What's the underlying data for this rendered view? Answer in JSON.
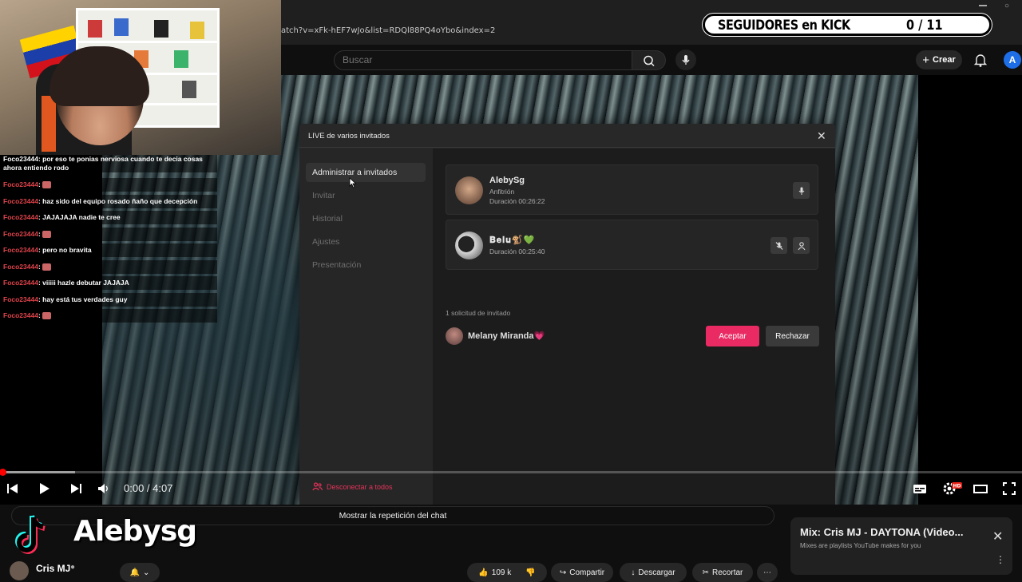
{
  "browser": {
    "url": "atch?v=xFk-hEF7wJo&list=RDQl88PQ4oYbo&index=2"
  },
  "header": {
    "search_placeholder": "Buscar",
    "create_label": "Crear",
    "avatar_letter": "A"
  },
  "overlay": {
    "kick_label": "SEGUIDORES en KICK",
    "kick_count": "0 / 11",
    "tiktok_handle": "Alebysg"
  },
  "chat": {
    "partial_line": "ahora entiendo rodo",
    "partial_top": "Foco23444: por eso te ponias nerviosa cuando te decia cosas",
    "messages": [
      {
        "user": "Foco23444",
        "text": "",
        "emote": true
      },
      {
        "user": "Foco23444",
        "text": "haz sido del equipo rosado ñaño que decepción",
        "emote": false
      },
      {
        "user": "Foco23444",
        "text": "JAJAJAJA nadie te cree",
        "emote": false
      },
      {
        "user": "Foco23444",
        "text": "",
        "emote": true
      },
      {
        "user": "Foco23444",
        "text": "pero no bravita",
        "emote": false
      },
      {
        "user": "Foco23444",
        "text": "",
        "emote": true
      },
      {
        "user": "Foco23444",
        "text": "viiiii hazle debutar JAJAJA",
        "emote": false
      },
      {
        "user": "Foco23444",
        "text": "hay está tus verdades guy",
        "emote": false
      },
      {
        "user": "Foco23444",
        "text": "",
        "emote": true
      }
    ]
  },
  "modal": {
    "title": "LIVE de varios invitados",
    "sidebar": {
      "items": [
        {
          "label": "Administrar a invitados",
          "active": true
        },
        {
          "label": "Invitar",
          "active": false
        },
        {
          "label": "Historial",
          "active": false
        },
        {
          "label": "Ajustes",
          "active": false
        },
        {
          "label": "Presentación",
          "active": false
        }
      ],
      "disconnect_label": "Desconectar a todos"
    },
    "guests": [
      {
        "name": "AlebySg",
        "role": "Anfitrión",
        "duration": "Duración 00:26:22"
      },
      {
        "name": "𝐁𝐞𝐥𝐮🐒💚",
        "role": "",
        "duration": "Duración 00:25:40"
      }
    ],
    "requests": {
      "label": "1 solicitud de invitado",
      "name": "Melany Miranda💗",
      "accept_label": "Aceptar",
      "reject_label": "Rechazar"
    }
  },
  "player": {
    "time": "0:00 / 4:07",
    "progress_fraction": 0.0
  },
  "below": {
    "chat_replay_label": "Mostrar la repetición del chat",
    "channel_name": "Cris MJ",
    "likes": "109 k",
    "share_label": "Compartir",
    "download_label": "Descargar",
    "clip_label": "Recortar"
  },
  "mix": {
    "title": "Mix: Cris MJ - DAYTONA (Video...",
    "subtitle": "Mixes are playlists YouTube makes for you"
  },
  "colors": {
    "accent_pink": "#ea2a63",
    "chat_user": "#e0434b",
    "progress": "#ff0000"
  }
}
